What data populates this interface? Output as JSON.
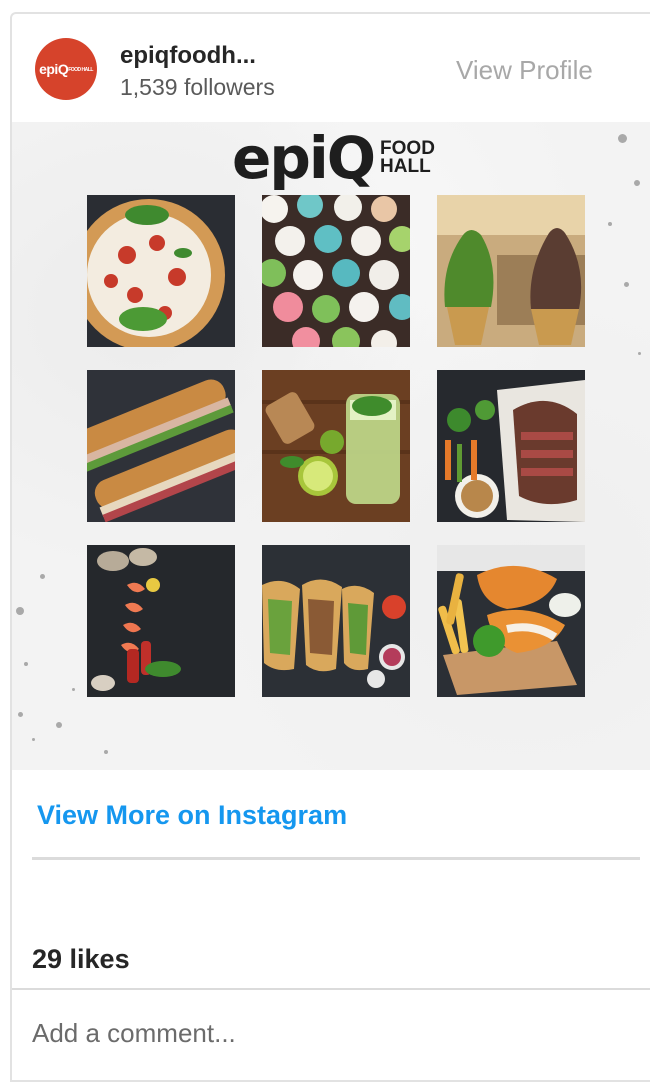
{
  "header": {
    "avatar_text": "epiQ",
    "avatar_sub": "FOOD HALL",
    "username": "epiqfoodh...",
    "followers": "1,539 followers",
    "view_profile": "View Profile"
  },
  "post": {
    "brand_main": "epiQ",
    "brand_sub_1": "FOOD",
    "brand_sub_2": "HALL",
    "tiles": [
      "pizza",
      "cupcakes",
      "soft-serve",
      "sandwich",
      "mojito",
      "steak",
      "seafood",
      "tacos",
      "fish-and-chips"
    ]
  },
  "actions": {
    "view_more": "View More on Instagram",
    "likes": "29 likes",
    "comment_placeholder": "Add a comment..."
  },
  "colors": {
    "avatar": "#d6432b",
    "link": "#1597ef"
  }
}
